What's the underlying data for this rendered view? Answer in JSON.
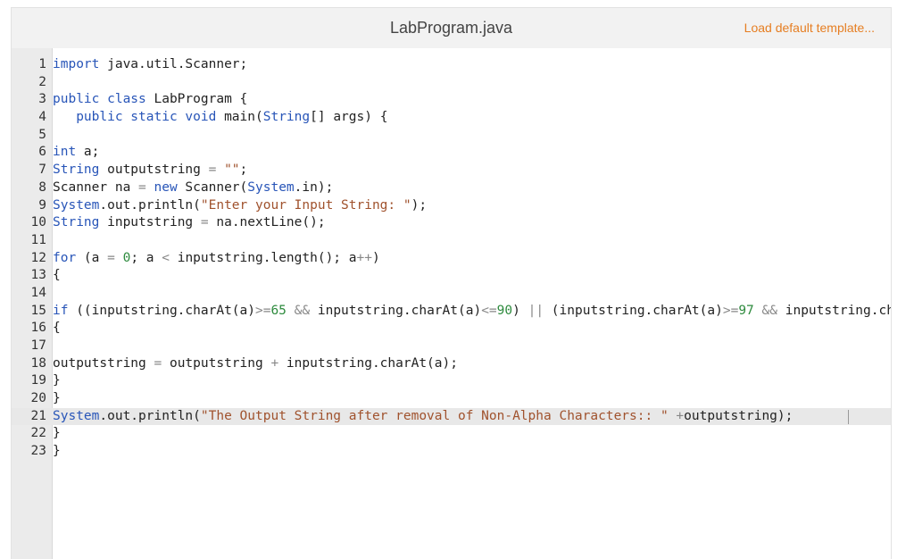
{
  "header": {
    "filename": "LabProgram.java",
    "load_default_label": "Load default template..."
  },
  "editor": {
    "active_line": 21,
    "lines": [
      {
        "n": "1",
        "segs": [
          {
            "t": "import",
            "c": "kw"
          },
          {
            "t": " java.util.Scanner;",
            "c": ""
          }
        ]
      },
      {
        "n": "2",
        "segs": []
      },
      {
        "n": "3",
        "segs": [
          {
            "t": "public class",
            "c": "kw"
          },
          {
            "t": " LabProgram {",
            "c": ""
          }
        ]
      },
      {
        "n": "4",
        "segs": [
          {
            "t": "   ",
            "c": ""
          },
          {
            "t": "public static void",
            "c": "kw"
          },
          {
            "t": " main(",
            "c": ""
          },
          {
            "t": "String",
            "c": "kw"
          },
          {
            "t": "[] args) {",
            "c": ""
          }
        ]
      },
      {
        "n": "5",
        "segs": []
      },
      {
        "n": "6",
        "segs": [
          {
            "t": "int",
            "c": "kw"
          },
          {
            "t": " a;",
            "c": ""
          }
        ]
      },
      {
        "n": "7",
        "segs": [
          {
            "t": "String",
            "c": "kw"
          },
          {
            "t": " outputstring ",
            "c": ""
          },
          {
            "t": "=",
            "c": "op"
          },
          {
            "t": " ",
            "c": ""
          },
          {
            "t": "\"\"",
            "c": "str"
          },
          {
            "t": ";",
            "c": ""
          }
        ]
      },
      {
        "n": "8",
        "segs": [
          {
            "t": "Scanner na ",
            "c": ""
          },
          {
            "t": "=",
            "c": "op"
          },
          {
            "t": " ",
            "c": ""
          },
          {
            "t": "new",
            "c": "kw"
          },
          {
            "t": " Scanner(",
            "c": ""
          },
          {
            "t": "System",
            "c": "kw"
          },
          {
            "t": ".in);",
            "c": ""
          }
        ]
      },
      {
        "n": "9",
        "segs": [
          {
            "t": "System",
            "c": "kw"
          },
          {
            "t": ".out.println(",
            "c": ""
          },
          {
            "t": "\"Enter your Input String: \"",
            "c": "str"
          },
          {
            "t": ");",
            "c": ""
          }
        ]
      },
      {
        "n": "10",
        "segs": [
          {
            "t": "String",
            "c": "kw"
          },
          {
            "t": " inputstring ",
            "c": ""
          },
          {
            "t": "=",
            "c": "op"
          },
          {
            "t": " na.nextLine();",
            "c": ""
          }
        ]
      },
      {
        "n": "11",
        "segs": []
      },
      {
        "n": "12",
        "segs": [
          {
            "t": "for",
            "c": "kw"
          },
          {
            "t": " (a ",
            "c": ""
          },
          {
            "t": "=",
            "c": "op"
          },
          {
            "t": " ",
            "c": ""
          },
          {
            "t": "0",
            "c": "num"
          },
          {
            "t": "; a ",
            "c": ""
          },
          {
            "t": "<",
            "c": "op"
          },
          {
            "t": " inputstring.length(); a",
            "c": ""
          },
          {
            "t": "++",
            "c": "op"
          },
          {
            "t": ")",
            "c": ""
          }
        ]
      },
      {
        "n": "13",
        "segs": [
          {
            "t": "{",
            "c": ""
          }
        ]
      },
      {
        "n": "14",
        "segs": []
      },
      {
        "n": "15",
        "segs": [
          {
            "t": "if",
            "c": "kw"
          },
          {
            "t": " ((inputstring.charAt(a)",
            "c": ""
          },
          {
            "t": ">=",
            "c": "op"
          },
          {
            "t": "65",
            "c": "num"
          },
          {
            "t": " ",
            "c": ""
          },
          {
            "t": "&&",
            "c": "op"
          },
          {
            "t": " inputstring.charAt(a)",
            "c": ""
          },
          {
            "t": "<=",
            "c": "op"
          },
          {
            "t": "90",
            "c": "num"
          },
          {
            "t": ") ",
            "c": ""
          },
          {
            "t": "||",
            "c": "op"
          },
          {
            "t": " (inputstring.charAt(a)",
            "c": ""
          },
          {
            "t": ">=",
            "c": "op"
          },
          {
            "t": "97",
            "c": "num"
          },
          {
            "t": " ",
            "c": ""
          },
          {
            "t": "&&",
            "c": "op"
          },
          {
            "t": " inputstring.ch",
            "c": ""
          }
        ]
      },
      {
        "n": "16",
        "segs": [
          {
            "t": "{",
            "c": ""
          }
        ]
      },
      {
        "n": "17",
        "segs": []
      },
      {
        "n": "18",
        "segs": [
          {
            "t": "outputstring ",
            "c": ""
          },
          {
            "t": "=",
            "c": "op"
          },
          {
            "t": " outputstring ",
            "c": ""
          },
          {
            "t": "+",
            "c": "op"
          },
          {
            "t": " inputstring.charAt(a);",
            "c": ""
          }
        ]
      },
      {
        "n": "19",
        "segs": [
          {
            "t": "}",
            "c": ""
          }
        ]
      },
      {
        "n": "20",
        "segs": [
          {
            "t": "}",
            "c": ""
          }
        ]
      },
      {
        "n": "21",
        "segs": [
          {
            "t": "System",
            "c": "kw"
          },
          {
            "t": ".out.println(",
            "c": ""
          },
          {
            "t": "\"The Output String after removal of Non-Alpha Characters:: \"",
            "c": "str"
          },
          {
            "t": " ",
            "c": ""
          },
          {
            "t": "+",
            "c": "op"
          },
          {
            "t": "outputstring);",
            "c": ""
          }
        ]
      },
      {
        "n": "22",
        "segs": [
          {
            "t": "}",
            "c": ""
          }
        ]
      },
      {
        "n": "23",
        "segs": [
          {
            "t": "}",
            "c": ""
          }
        ]
      }
    ]
  },
  "colors": {
    "keyword": "#2855b8",
    "string": "#a0522d",
    "number": "#2e8b3e",
    "operator": "#888888",
    "load_button": "#e67e22"
  }
}
